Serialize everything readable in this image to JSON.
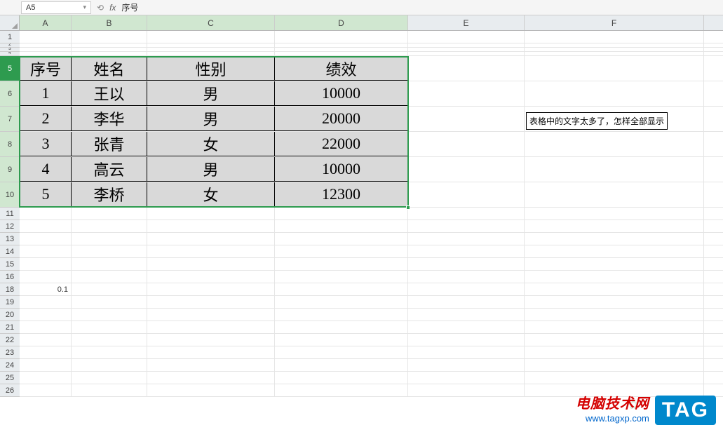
{
  "name_box": "A5",
  "formula_bar": "序号",
  "columns": [
    "A",
    "B",
    "C",
    "D",
    "E",
    "F"
  ],
  "row_labels_top": [
    "1",
    "2",
    "3",
    "4"
  ],
  "data_row_labels": [
    "5",
    "6",
    "7",
    "8",
    "9",
    "10"
  ],
  "row_labels_bottom": [
    "11",
    "12",
    "13",
    "14",
    "15",
    "16",
    "18",
    "19",
    "20",
    "21",
    "22",
    "23",
    "24",
    "25",
    "26"
  ],
  "active_cell": "A5",
  "selection": "A5:D10",
  "table": {
    "headers": [
      "序号",
      "姓名",
      "性别",
      "绩效"
    ],
    "rows": [
      [
        "1",
        "王以",
        "男",
        "10000"
      ],
      [
        "2",
        "李华",
        "男",
        "20000"
      ],
      [
        "3",
        "张青",
        "女",
        "22000"
      ],
      [
        "4",
        "高云",
        "男",
        "10000"
      ],
      [
        "5",
        "李桥",
        "女",
        "12300"
      ]
    ]
  },
  "note": "表格中的文字太多了，怎样全部显示",
  "a18_value": "0.1",
  "watermark": {
    "line1": "电脑技术网",
    "line2": "www.tagxp.com",
    "tag": "TAG"
  }
}
